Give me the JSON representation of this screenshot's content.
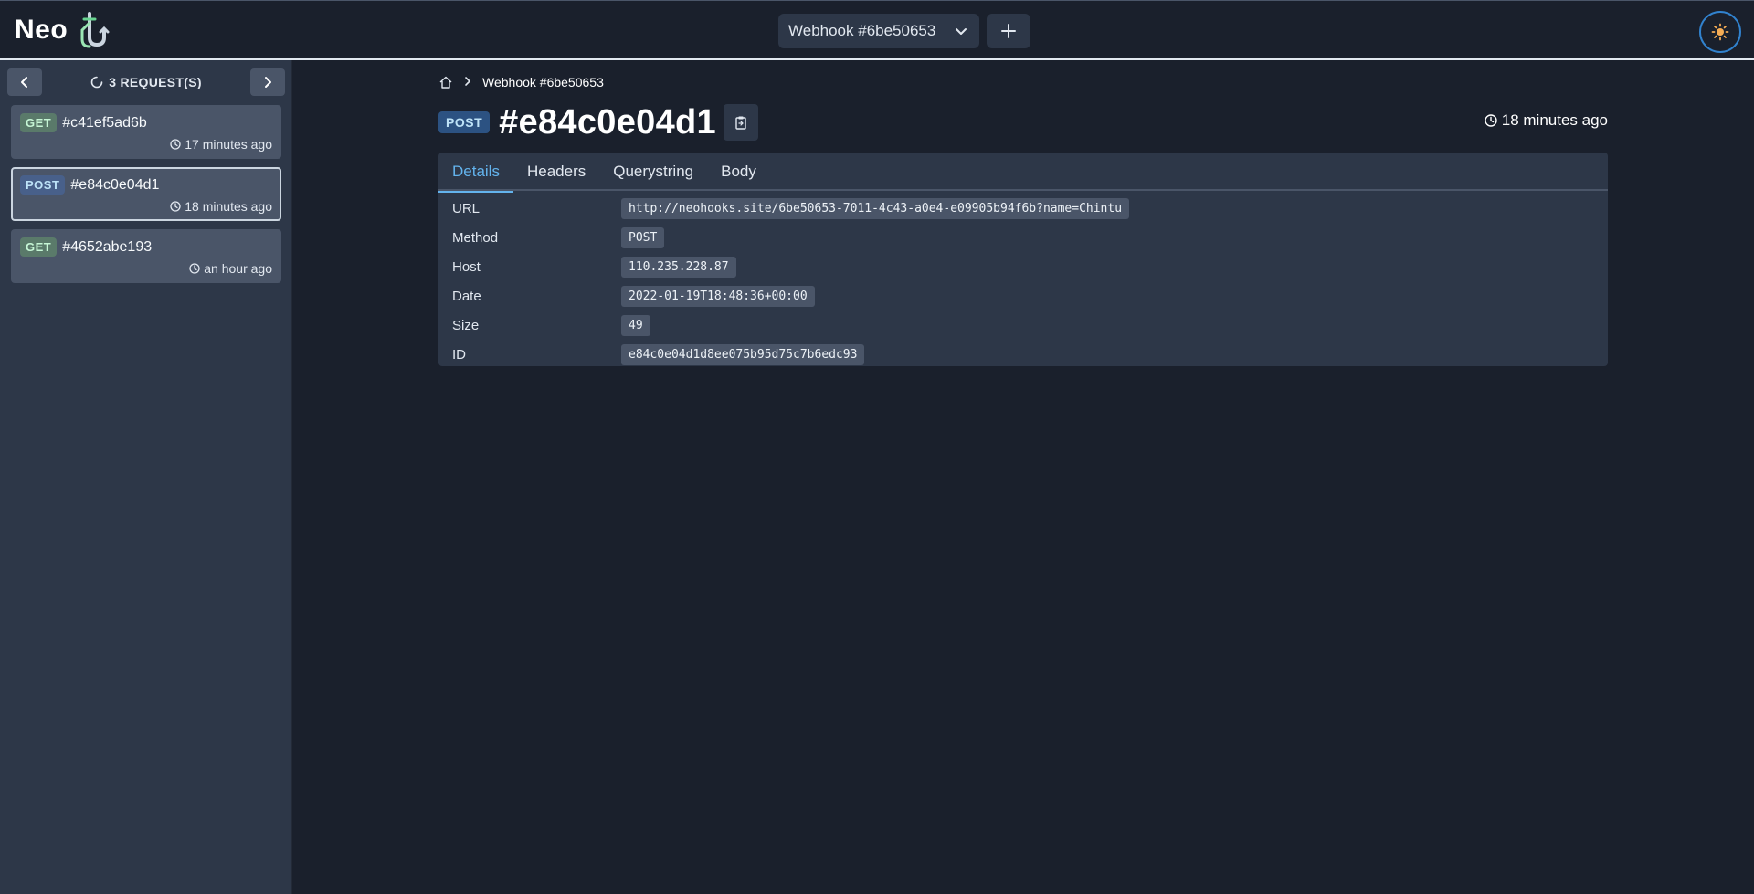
{
  "app": {
    "logo_text": "Neo"
  },
  "topbar": {
    "webhook_select": "Webhook #6be50653"
  },
  "sidebar": {
    "request_count": "3 REQUEST(S)",
    "requests": [
      {
        "method": "GET",
        "id": "#c41ef5ad6b",
        "time": "17 minutes ago"
      },
      {
        "method": "POST",
        "id": "#e84c0e04d1",
        "time": "18 minutes ago"
      },
      {
        "method": "GET",
        "id": "#4652abe193",
        "time": "an hour ago"
      }
    ]
  },
  "main": {
    "breadcrumb": {
      "current": "Webhook #6be50653"
    },
    "method": "POST",
    "title": "#e84c0e04d1",
    "time": "18 minutes ago",
    "tabs": [
      {
        "label": "Details"
      },
      {
        "label": "Headers"
      },
      {
        "label": "Querystring"
      },
      {
        "label": "Body"
      }
    ],
    "details": [
      {
        "key": "URL",
        "value": "http://neohooks.site/6be50653-7011-4c43-a0e4-e09905b94f6b?name=Chintu"
      },
      {
        "key": "Method",
        "value": "POST"
      },
      {
        "key": "Host",
        "value": "110.235.228.87"
      },
      {
        "key": "Date",
        "value": "2022-01-19T18:48:36+00:00"
      },
      {
        "key": "Size",
        "value": "49"
      },
      {
        "key": "ID",
        "value": "e84c0e04d1d8ee075b95d75c7b6edc93"
      }
    ]
  },
  "colors": {
    "background": "#1a202c",
    "surface": "#2d3748",
    "accent": "#63b3ed",
    "get_badge": "#5a7a6a",
    "post_badge": "#2c5282"
  }
}
